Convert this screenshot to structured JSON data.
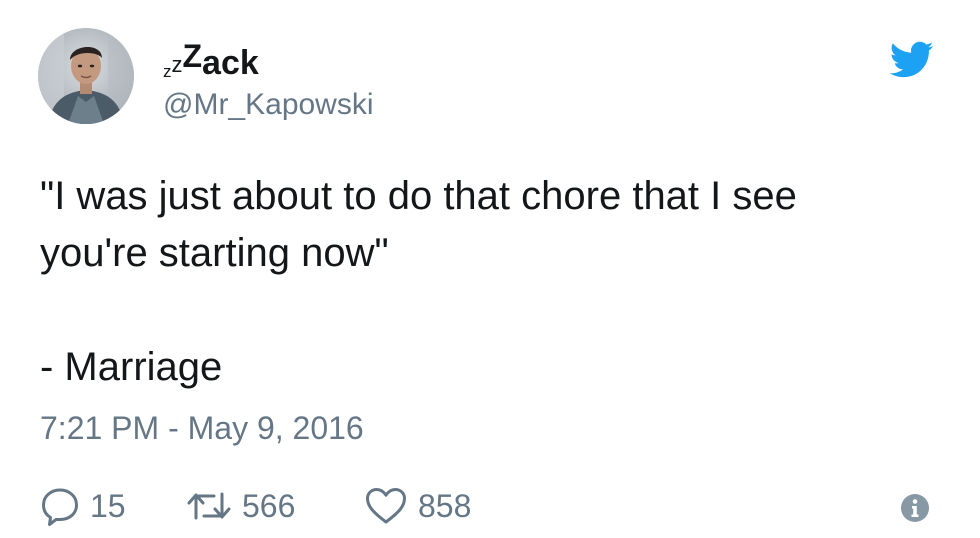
{
  "author": {
    "display_name_zz": [
      "z",
      "z",
      "Z"
    ],
    "display_name_rest": "ack",
    "handle": "@Mr_Kapowski",
    "avatar_icon": "profile-photo"
  },
  "brand": {
    "icon": "twitter-bird-icon",
    "color": "#1da1f2"
  },
  "tweet": {
    "lines": [
      "\"I was just about to do that chore that I see",
      "you're starting now\"",
      "",
      "- Marriage"
    ],
    "timestamp": "7:21 PM - May 9, 2016"
  },
  "actions": {
    "reply": {
      "icon": "reply-bubble-icon",
      "count": "15"
    },
    "retweet": {
      "icon": "retweet-icon",
      "count": "566"
    },
    "like": {
      "icon": "heart-icon",
      "count": "858"
    },
    "info": {
      "icon": "info-icon"
    }
  },
  "colors": {
    "text": "#14171a",
    "secondary_text": "#657786",
    "icon_gray": "#8899a6"
  }
}
